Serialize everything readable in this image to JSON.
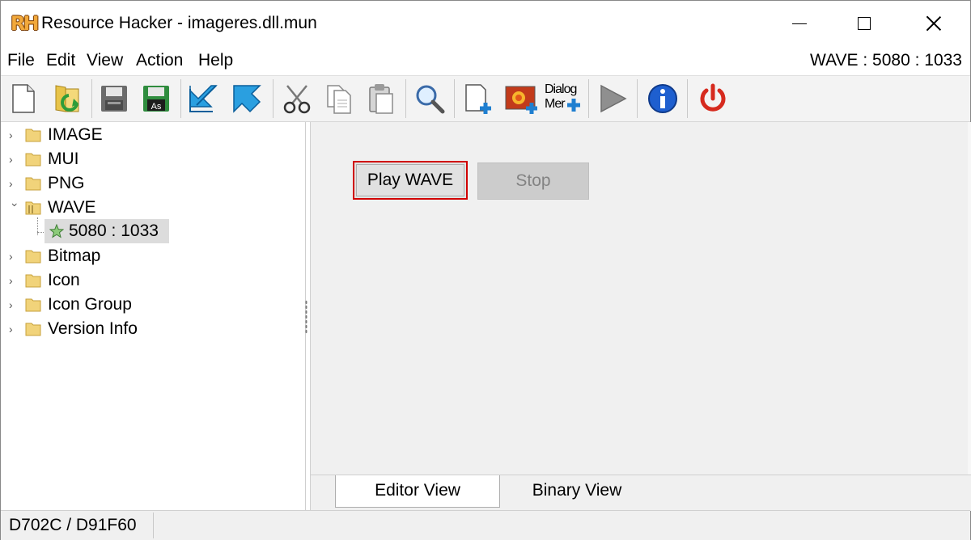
{
  "window": {
    "logo_text": "RH",
    "title": "Resource Hacker - imageres.dll.mun"
  },
  "menu": {
    "items": [
      "File",
      "Edit",
      "View",
      "Action",
      "Help"
    ],
    "resource_status": "WAVE : 5080 : 1033"
  },
  "toolbar": {
    "buttons": [
      {
        "name": "new",
        "icon": "new-file-icon"
      },
      {
        "name": "open",
        "icon": "open-folder-icon"
      },
      {
        "name": "save",
        "icon": "save-icon"
      },
      {
        "name": "save-as",
        "icon": "save-as-icon",
        "label": "As"
      },
      {
        "name": "compile",
        "icon": "compile-arrow-icon"
      },
      {
        "name": "go-back",
        "icon": "back-arrow-icon"
      },
      {
        "name": "cut",
        "icon": "scissors-icon"
      },
      {
        "name": "copy",
        "icon": "copy-icon"
      },
      {
        "name": "paste",
        "icon": "paste-icon"
      },
      {
        "name": "find",
        "icon": "magnifier-icon"
      },
      {
        "name": "add-blank-resource",
        "icon": "add-blank-icon"
      },
      {
        "name": "add-image-resource",
        "icon": "add-image-icon"
      },
      {
        "name": "dialog-menu",
        "icon": "dialog-menu-icon",
        "label": "Dialog Mer"
      },
      {
        "name": "play",
        "icon": "play-icon"
      },
      {
        "name": "about",
        "icon": "info-icon"
      },
      {
        "name": "exit",
        "icon": "power-icon"
      }
    ]
  },
  "tree": {
    "nodes": [
      {
        "label": "IMAGE",
        "expanded": false
      },
      {
        "label": "MUI",
        "expanded": false
      },
      {
        "label": "PNG",
        "expanded": false
      },
      {
        "label": "WAVE",
        "expanded": true,
        "children": [
          {
            "label": "5080 : 1033",
            "selected": true
          }
        ]
      },
      {
        "label": "Bitmap",
        "expanded": false
      },
      {
        "label": "Icon",
        "expanded": false
      },
      {
        "label": "Icon Group",
        "expanded": false
      },
      {
        "label": "Version Info",
        "expanded": false
      }
    ]
  },
  "editor": {
    "play_label": "Play WAVE",
    "stop_label": "Stop",
    "highlight_color": "#d00000"
  },
  "tabs": [
    {
      "label": "Editor View",
      "active": true
    },
    {
      "label": "Binary View",
      "active": false
    }
  ],
  "status": {
    "offsets": "D702C / D91F60"
  }
}
